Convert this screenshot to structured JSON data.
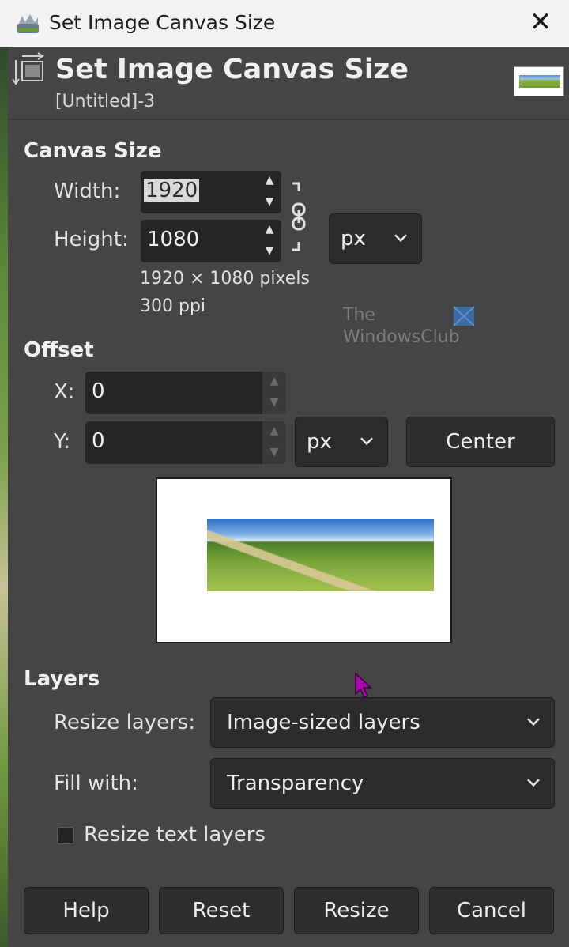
{
  "window": {
    "title": "Set Image Canvas Size",
    "close_glyph": "✕"
  },
  "header": {
    "title": "Set Image Canvas Size",
    "subtitle": "[Untitled]-3"
  },
  "canvas_size": {
    "section_label": "Canvas Size",
    "width_label": "Width:",
    "width_value": "1920",
    "height_label": "Height:",
    "height_value": "1080",
    "unit": "px",
    "pixels_info": "1920 × 1080 pixels",
    "ppi_info": "300 ppi"
  },
  "offset": {
    "section_label": "Offset",
    "x_label": "X:",
    "x_value": "0",
    "y_label": "Y:",
    "y_value": "0",
    "unit": "px",
    "center_label": "Center"
  },
  "watermark": {
    "line1": "The",
    "line2": "WindowsClub"
  },
  "layers": {
    "section_label": "Layers",
    "resize_label": "Resize layers:",
    "resize_value": "Image-sized layers",
    "fill_label": "Fill with:",
    "fill_value": "Transparency",
    "resize_text_label": "Resize text layers",
    "resize_text_checked": false
  },
  "buttons": {
    "help": "Help",
    "reset": "Reset",
    "resize": "Resize",
    "cancel": "Cancel"
  },
  "colors": {
    "dialog_bg": "#454545",
    "field_bg": "#262626",
    "cursor": "#b000b5"
  },
  "icons": {
    "app": "gimp-icon",
    "header": "canvas-size-icon",
    "chain": "chain-link-icon",
    "dropdown": "chevron-down-icon"
  }
}
